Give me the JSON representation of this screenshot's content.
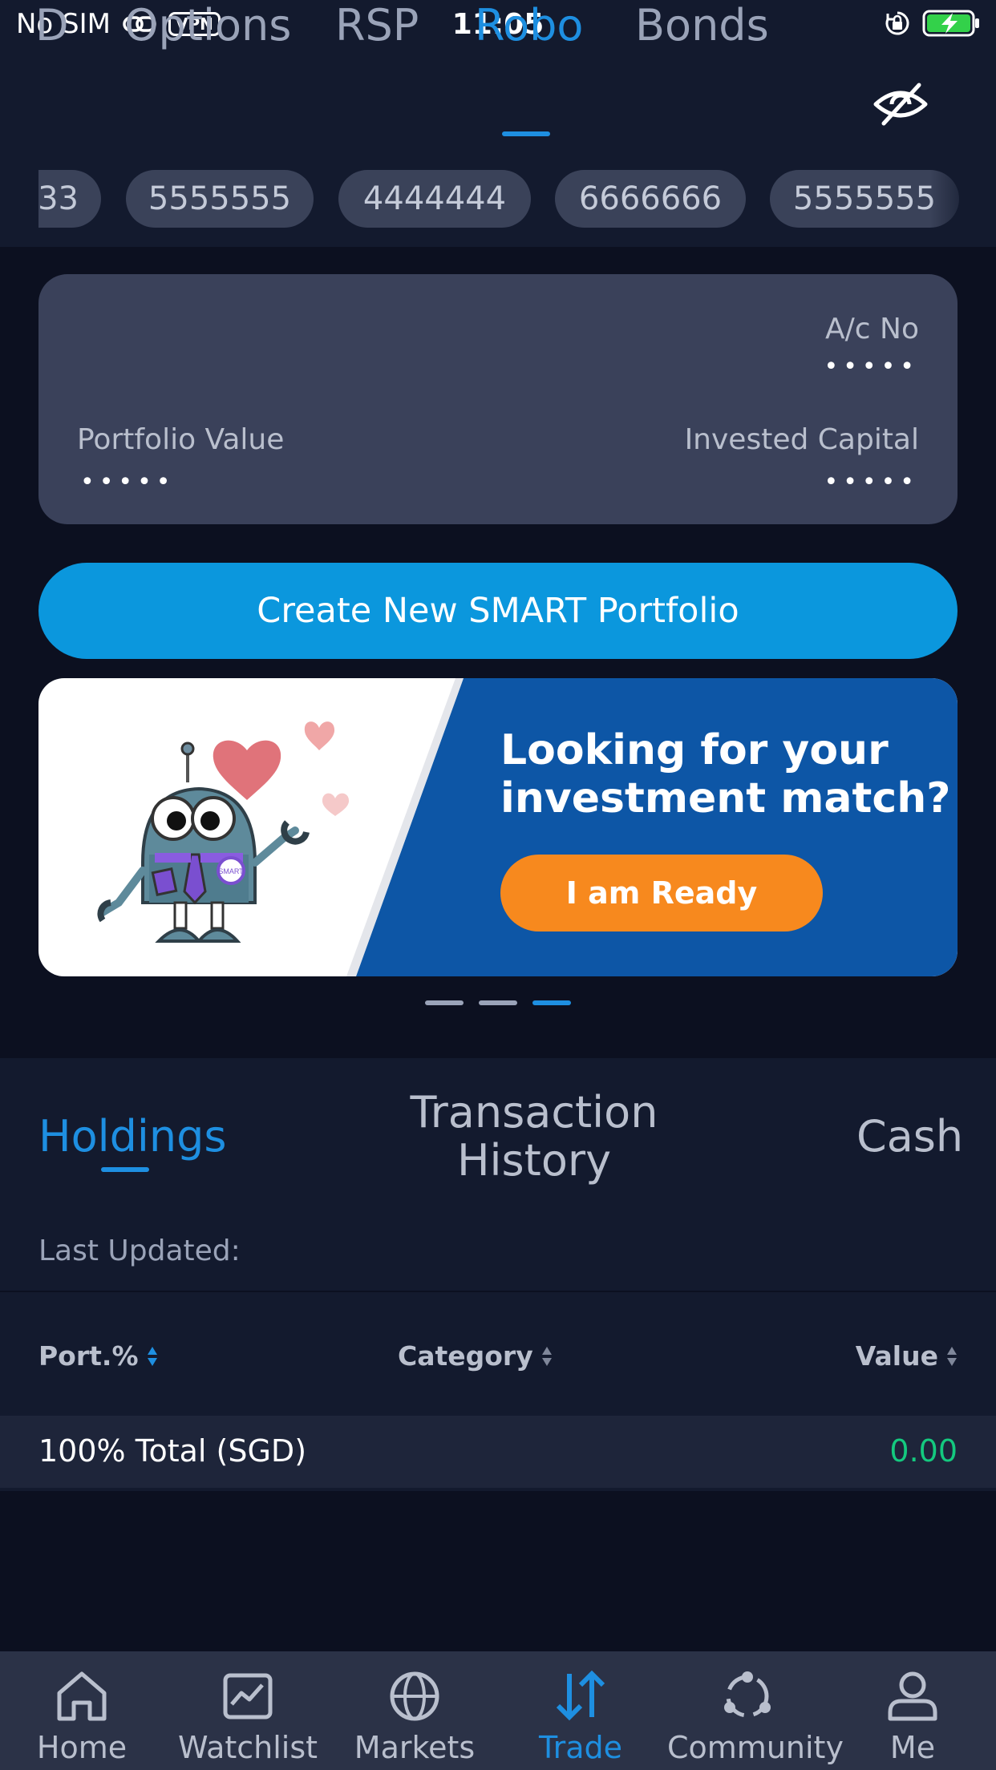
{
  "status_bar": {
    "carrier": "No SIM",
    "vpn": "VPN",
    "time": "11:05"
  },
  "top_tabs": [
    {
      "label": "D"
    },
    {
      "label": "Options"
    },
    {
      "label": "RSP"
    },
    {
      "label": "Robo",
      "active": true
    },
    {
      "label": "Bonds"
    }
  ],
  "account_chips": [
    "33",
    "5555555",
    "4444444",
    "6666666",
    "5555555"
  ],
  "account_card": {
    "ac_no_label": "A/c No",
    "ac_no_value": "•••••",
    "portfolio_value_label": "Portfolio Value",
    "portfolio_value": "•••••",
    "invested_capital_label": "Invested Capital",
    "invested_capital": "•••••"
  },
  "create_button": "Create New SMART Portfolio",
  "banner": {
    "line1": "Looking for your",
    "line2": "investment match?",
    "button": "I am Ready",
    "robot_badge": "SMART",
    "pager_count": 3,
    "pager_active": 3
  },
  "sub_tabs": {
    "holdings": "Holdings",
    "transaction_line1": "Transaction",
    "transaction_line2": "History",
    "cash": "Cash"
  },
  "last_updated": "Last Updated:",
  "table": {
    "columns": [
      "Port.%",
      "Category",
      "Value"
    ],
    "total_label": "100% Total (SGD)",
    "total_value": "0.00"
  },
  "bottom_nav": [
    {
      "label": "Home",
      "icon": "home-icon"
    },
    {
      "label": "Watchlist",
      "icon": "chart-icon"
    },
    {
      "label": "Markets",
      "icon": "globe-icon"
    },
    {
      "label": "Trade",
      "icon": "trade-arrows-icon",
      "active": true
    },
    {
      "label": "Community",
      "icon": "community-icon"
    },
    {
      "label": "Me",
      "icon": "person-icon"
    }
  ],
  "colors": {
    "accent": "#1e8fe1",
    "create_button": "#0b97dd",
    "banner_blue": "#0d56a6",
    "ready_orange": "#f7891e",
    "positive_green": "#14c97f"
  }
}
